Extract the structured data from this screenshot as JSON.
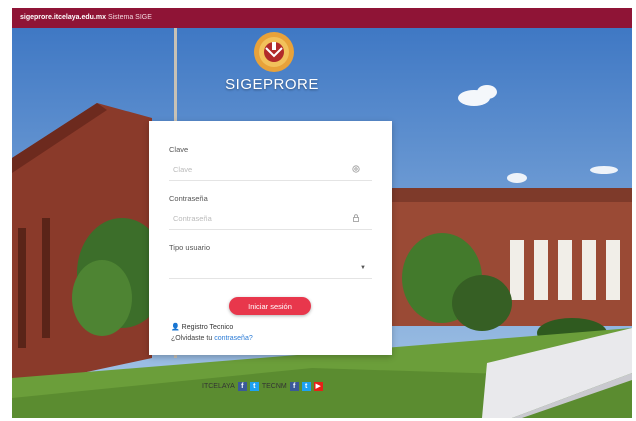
{
  "topbar": {
    "title": "sigeprore.itcelaya.edu.mx",
    "suffix": "Sistema SIGE"
  },
  "brand": {
    "name": "SIGEPRORE"
  },
  "form": {
    "clave_label": "Clave",
    "clave_placeholder": "Clave",
    "password_label": "Contraseña",
    "password_placeholder": "Contraseña",
    "tipo_label": "Tipo usuario",
    "tipo_selected": "",
    "login_button": "Iniciar sesión",
    "register_link": "Registro Tecnico",
    "forgot_prefix": "¿Olvidaste tu",
    "forgot_link": "contraseña?"
  },
  "footer": {
    "credit": "",
    "social_1": "ITCELAYA",
    "social_2": "TECNM"
  },
  "colors": {
    "topbar": "#8f1436",
    "button": "#e8374c",
    "link": "#2b7bd6"
  },
  "icons": [
    "crest-logo-icon",
    "at-sign-icon",
    "lock-icon",
    "chevron-down-icon",
    "user-icon",
    "facebook-icon",
    "twitter-icon",
    "youtube-icon"
  ]
}
